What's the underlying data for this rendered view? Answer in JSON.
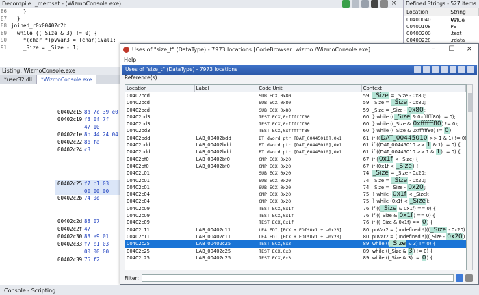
{
  "decompile": {
    "title": "Decompile: _memset - (WizmoConsole.exe)",
    "lines": [
      {
        "n": "86",
        "t": "    }"
      },
      {
        "n": "87",
        "t": "  }"
      },
      {
        "n": "88",
        "t": "joined_r0x00402c2b:"
      },
      {
        "n": "89",
        "t": "  while ((_Size & 3) != 0) {"
      },
      {
        "n": "90",
        "t": "    *(char *)pvVar3 = (char)iVal1;"
      },
      {
        "n": "91",
        "t": "    _Size = _Size - 1;"
      }
    ]
  },
  "listing": {
    "title": "Listing: WizmoConsole.exe",
    "tabs": [
      "*user32.dll",
      "*WizmoConsole.exe"
    ],
    "rows": [
      {
        "addr": "00402c15",
        "bytes": "8d 7c 39 e0"
      },
      {
        "addr": "00402c19",
        "bytes": "f3 0f 7f"
      },
      {
        "addr": "",
        "bytes": "47 10"
      },
      {
        "addr": "00402c1e",
        "bytes": "8b 44 24 04"
      },
      {
        "addr": "00402c22",
        "bytes": "8b fa"
      },
      {
        "addr": "00402c24",
        "bytes": "c3"
      },
      {
        "addr": "00402c25",
        "bytes": "f7 c1 03"
      },
      {
        "addr": "",
        "bytes": "00 00 00"
      },
      {
        "addr": "00402c2b",
        "bytes": "74 0e"
      },
      {
        "addr": "00402c2d",
        "bytes": "88 07"
      },
      {
        "addr": "00402c2f",
        "bytes": "47"
      },
      {
        "addr": "00402c30",
        "bytes": "83 e9 01"
      },
      {
        "addr": "00402c33",
        "bytes": "f7 c1 03"
      },
      {
        "addr": "",
        "bytes": "00 00 00"
      },
      {
        "addr": "00402c39",
        "bytes": "75 f2"
      }
    ]
  },
  "strings": {
    "title": "Defined Strings - 527 items",
    "col_location": "Location",
    "col_value": "String Value",
    "rows": [
      {
        "loc": "00400040",
        "val": "MZ"
      },
      {
        "loc": "00400108",
        "val": "PE"
      },
      {
        "loc": "00400200",
        "val": ".text"
      },
      {
        "loc": "00400228",
        "val": ".rdata"
      }
    ]
  },
  "dialog": {
    "title": "Uses of \"size_t\" (DataType) - 7973 locations [CodeBrowser: wizmo:/WizmoConsole.exe]",
    "menu_help": "Help",
    "header": "Uses of \"size_t\" (DataType) - 7973 locations",
    "references_label": "Reference(s)",
    "columns": [
      "Location",
      "Label",
      "Code Unit",
      "Context"
    ],
    "filter_label": "Filter:",
    "rows": [
      {
        "loc": "00402bcd",
        "label": "",
        "code": "SUB ECX,0x80",
        "ln": "59:",
        "pre": "",
        "hi": "_Size",
        "post": " = _Size - 0x80;"
      },
      {
        "loc": "00402bcd",
        "label": "",
        "code": "SUB ECX,0x80",
        "ln": "59:",
        "pre": "_Size = ",
        "hi": "_Size",
        "post": " - 0x80;"
      },
      {
        "loc": "00402bcd",
        "label": "",
        "code": "SUB ECX,0x80",
        "ln": "59:",
        "pre": "_Size = _Size - ",
        "hi": "0x80",
        "post": ";"
      },
      {
        "loc": "00402bd3",
        "label": "",
        "code": "TEST ECX,0xffffff80",
        "ln": "60:",
        "pre": "} while ((",
        "hi": "_Size",
        "post": " & 0xffffff80) != 0);"
      },
      {
        "loc": "00402bd3",
        "label": "",
        "code": "TEST ECX,0xffffff80",
        "ln": "60:",
        "pre": "} while ((_Size & ",
        "hi": "0xffffff80",
        "post": ") != 0);"
      },
      {
        "loc": "00402bd3",
        "label": "",
        "code": "TEST ECX,0xffffff80",
        "ln": "60:",
        "pre": "} while ((_Size & 0xffffff80) != ",
        "hi": "0",
        "post": ");"
      },
      {
        "loc": "00402bdd",
        "label": "LAB_00402bdd",
        "code": "BT dword ptr [DAT_00445010],0x1",
        "ln": "61:",
        "pre": "if ((",
        "hi": "DAT_00445010",
        "post": " >> 1 & 1) != 0) {"
      },
      {
        "loc": "00402bdd",
        "label": "LAB_00402bdd",
        "code": "BT dword ptr [DAT_00445010],0x1",
        "ln": "61:",
        "pre": "if ((DAT_00445010 >> ",
        "hi": "1",
        "post": " & 1) != 0) {"
      },
      {
        "loc": "00402bdd",
        "label": "LAB_00402bdd",
        "code": "BT dword ptr [DAT_00445010],0x1",
        "ln": "61:",
        "pre": "if ((DAT_00445010 >> 1 & ",
        "hi": "1",
        "post": ") != 0) {"
      },
      {
        "loc": "00402bf0",
        "label": "LAB_00402bf0",
        "code": "CMP ECX,0x20",
        "ln": "67:",
        "pre": "if (",
        "hi": "0x1f",
        "post": " < _Size) {"
      },
      {
        "loc": "00402bf0",
        "label": "LAB_00402bf0",
        "code": "CMP ECX,0x20",
        "ln": "67:",
        "pre": "if (0x1f < ",
        "hi": "_Size",
        "post": ") {"
      },
      {
        "loc": "00402c01",
        "label": "",
        "code": "SUB ECX,0x20",
        "ln": "74:",
        "pre": "",
        "hi": "_Size",
        "post": " = _Size - 0x20;"
      },
      {
        "loc": "00402c01",
        "label": "",
        "code": "SUB ECX,0x20",
        "ln": "74:",
        "pre": "_Size = ",
        "hi": "_Size",
        "post": " - 0x20;"
      },
      {
        "loc": "00402c01",
        "label": "",
        "code": "SUB ECX,0x20",
        "ln": "74:",
        "pre": "_Size = _Size - ",
        "hi": "0x20",
        "post": ";"
      },
      {
        "loc": "00402c04",
        "label": "",
        "code": "CMP ECX,0x20",
        "ln": "75:",
        "pre": "} while (",
        "hi": "0x1f",
        "post": " < _Size);"
      },
      {
        "loc": "00402c04",
        "label": "",
        "code": "CMP ECX,0x20",
        "ln": "75:",
        "pre": "} while (0x1f < ",
        "hi": "_Size",
        "post": ");"
      },
      {
        "loc": "00402c09",
        "label": "",
        "code": "TEST ECX,0x1f",
        "ln": "76:",
        "pre": "if ((",
        "hi": "_Size",
        "post": " & 0x1f) == 0) {"
      },
      {
        "loc": "00402c09",
        "label": "",
        "code": "TEST ECX,0x1f",
        "ln": "76:",
        "pre": "if ((_Size & ",
        "hi": "0x1f",
        "post": ") == 0) {"
      },
      {
        "loc": "00402c09",
        "label": "",
        "code": "TEST ECX,0x1f",
        "ln": "76:",
        "pre": "if ((_Size & 0x1f) == ",
        "hi": "0",
        "post": ") {"
      },
      {
        "loc": "00402c11",
        "label": "LAB_00402c11",
        "code": "LEA EDI,[ECX + EDI*0x1 + -0x20]",
        "ln": "80:",
        "pre": "puVar2 = (undefined *)((",
        "hi": "_Size",
        "post": " - 0x20) + (in"
      },
      {
        "loc": "00402c11",
        "label": "LAB_00402c11",
        "code": "LEA EDI,[ECX + EDI*0x1 + -0x20]",
        "ln": "80:",
        "pre": "puVar2 = (undefined *)((_Size - ",
        "hi": "0x20",
        "post": ") + (in"
      },
      {
        "loc": "00402c25",
        "label": "LAB_00402c25",
        "code": "TEST ECX,0x3",
        "ln": "89:",
        "pre": "while ((",
        "hi": "_Size",
        "post": " & 3) != 0) {",
        "selected": true
      },
      {
        "loc": "00402c25",
        "label": "LAB_00402c25",
        "code": "TEST ECX,0x3",
        "ln": "89:",
        "pre": "while ((_Size & ",
        "hi": "3",
        "post": ") != 0) {"
      },
      {
        "loc": "00402c25",
        "label": "LAB_00402c25",
        "code": "TEST ECX,0x3",
        "ln": "89:",
        "pre": "while ((_Size & 3) != ",
        "hi": "0",
        "post": ") {"
      }
    ]
  },
  "console": {
    "title": "Console - Scripting"
  }
}
